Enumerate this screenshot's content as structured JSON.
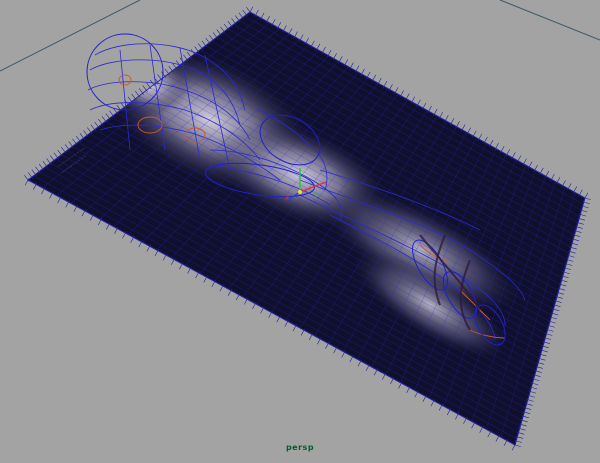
{
  "viewport": {
    "camera_name": "persp"
  },
  "colors": {
    "background": "#a3a3a3",
    "grid_lines": "#7a8a9a",
    "mesh_wire": "#2a2ad0",
    "plane_fill": "#10102e",
    "curve_orange": "#c85a28",
    "manip_red": "#e03030",
    "manip_green": "#30c030",
    "camera_label": "#0a5a2a"
  },
  "icons": {
    "camera_label": "text-label",
    "manipulator": "move-manipulator-icon"
  }
}
